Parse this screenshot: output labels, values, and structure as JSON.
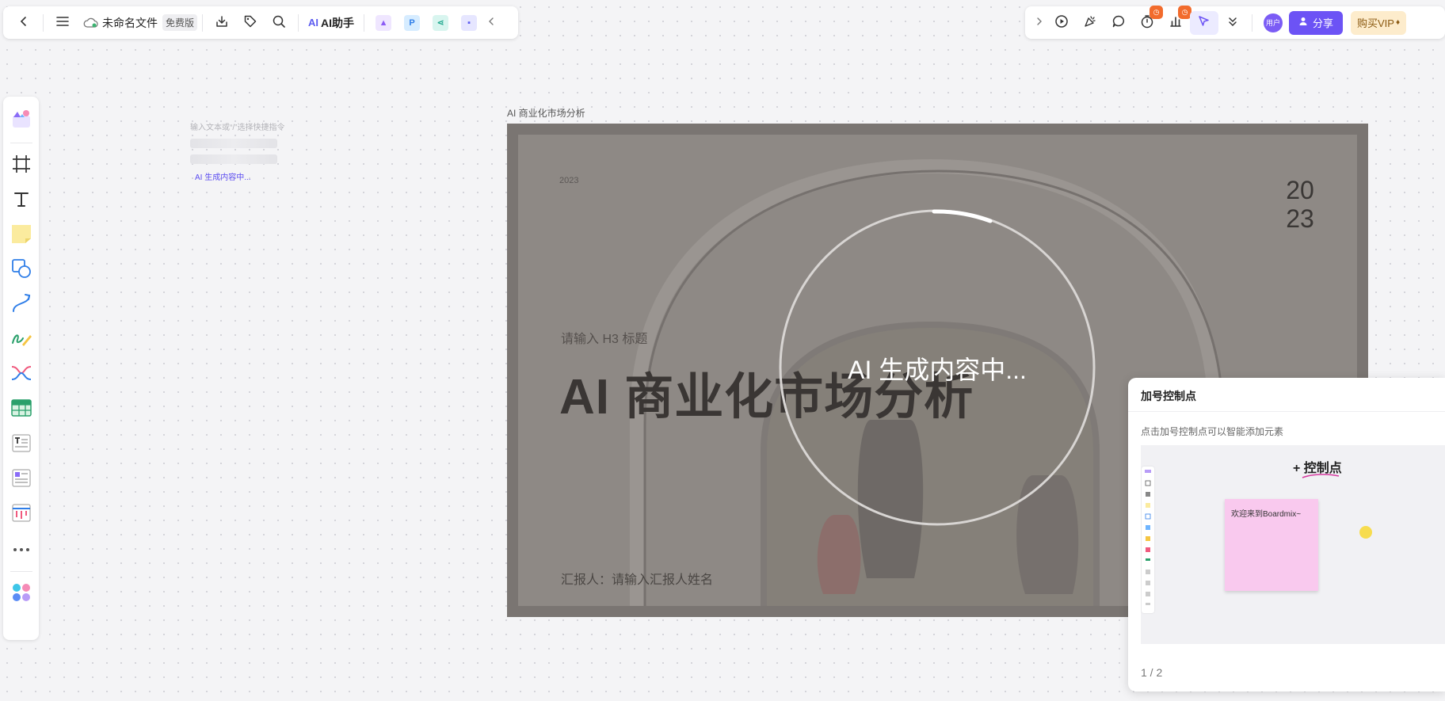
{
  "topbar": {
    "file_name": "未命名文件",
    "plan_badge": "免费版",
    "ai_helper_label": "AI助手",
    "ai_logo": "AI"
  },
  "topbar_right": {
    "avatar_text": "用户",
    "share_label": "分享",
    "vip_label": "购买VIP"
  },
  "prompt": {
    "hint": "输入文本或“/”选择快捷指令",
    "status": "AI 生成内容中..."
  },
  "frame": {
    "label": "AI 商业化市场分析"
  },
  "slide": {
    "year_small": "2023",
    "year_big_top": "20",
    "year_big_bottom": "23",
    "h3_placeholder": "请输入 H3 标题",
    "title": "AI 商业化市场分析",
    "reporter": "汇报人：请输入汇报人姓名"
  },
  "loader": {
    "text": "AI 生成内容中..."
  },
  "tip_panel": {
    "title": "加号控制点",
    "description": "点击加号控制点可以智能添加元素",
    "preview_label": "+ 控制点",
    "preview_sticky_text": "欢迎来到Boardmix~",
    "page_indicator": "1 / 2"
  },
  "colors": {
    "accent": "#6c53f5",
    "vip_bg": "#fdeccc",
    "notification": "#f26b2c",
    "slide_overlay": "#7a7572"
  }
}
